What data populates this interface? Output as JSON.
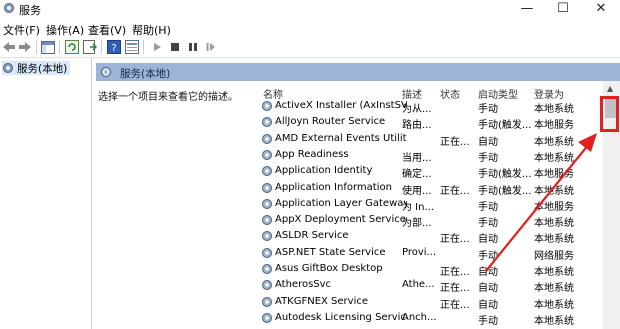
{
  "window": {
    "title": "服务"
  },
  "menu": [
    "文件(F)",
    "操作(A)",
    "查看(V)",
    "帮助(H)"
  ],
  "tree": {
    "item": "服务(本地)"
  },
  "panel": {
    "header": "服务(本地)",
    "description": "选择一个项目来查看它的描述。"
  },
  "columns": {
    "name": "名称",
    "desc": "描述",
    "state": "状态",
    "start": "启动类型",
    "logon": "登录为"
  },
  "services": [
    {
      "name": "ActiveX Installer (AxInstSV)",
      "desc": "为从...",
      "state": "",
      "start": "手动",
      "logon": "本地系统"
    },
    {
      "name": "AllJoyn Router Service",
      "desc": "路由...",
      "state": "",
      "start": "手动(触发...",
      "logon": "本地服务"
    },
    {
      "name": "AMD External Events Utility",
      "desc": "",
      "state": "正在...",
      "start": "自动",
      "logon": "本地系统"
    },
    {
      "name": "App Readiness",
      "desc": "当用...",
      "state": "",
      "start": "手动",
      "logon": "本地系统"
    },
    {
      "name": "Application Identity",
      "desc": "确定...",
      "state": "",
      "start": "手动(触发...",
      "logon": "本地服务"
    },
    {
      "name": "Application Information",
      "desc": "使用...",
      "state": "正在...",
      "start": "手动(触发...",
      "logon": "本地系统"
    },
    {
      "name": "Application Layer Gateway ...",
      "desc": "为 In...",
      "state": "",
      "start": "手动",
      "logon": "本地服务"
    },
    {
      "name": "AppX Deployment Service ...",
      "desc": "为部...",
      "state": "",
      "start": "手动",
      "logon": "本地系统"
    },
    {
      "name": "ASLDR Service",
      "desc": "",
      "state": "正在...",
      "start": "自动",
      "logon": "本地系统"
    },
    {
      "name": "ASP.NET State Service",
      "desc": "Provi...",
      "state": "",
      "start": "手动",
      "logon": "网络服务"
    },
    {
      "name": "Asus GiftBox Desktop",
      "desc": "",
      "state": "正在...",
      "start": "自动",
      "logon": "本地系统"
    },
    {
      "name": "AtherosSvc",
      "desc": "Athe...",
      "state": "正在...",
      "start": "自动",
      "logon": "本地系统"
    },
    {
      "name": "ATKGFNEX Service",
      "desc": "",
      "state": "正在...",
      "start": "自动",
      "logon": "本地系统"
    },
    {
      "name": "Autodesk Licensing Service",
      "desc": "Anch...",
      "state": "",
      "start": "手动",
      "logon": "本地系统"
    }
  ],
  "colors": {
    "header_bg": "#9cb5d6",
    "tree_sel": "#d9e8fb",
    "annotation": "#e32020"
  },
  "icons": {
    "app": "gear-services-icon",
    "service": "gear-icon"
  }
}
